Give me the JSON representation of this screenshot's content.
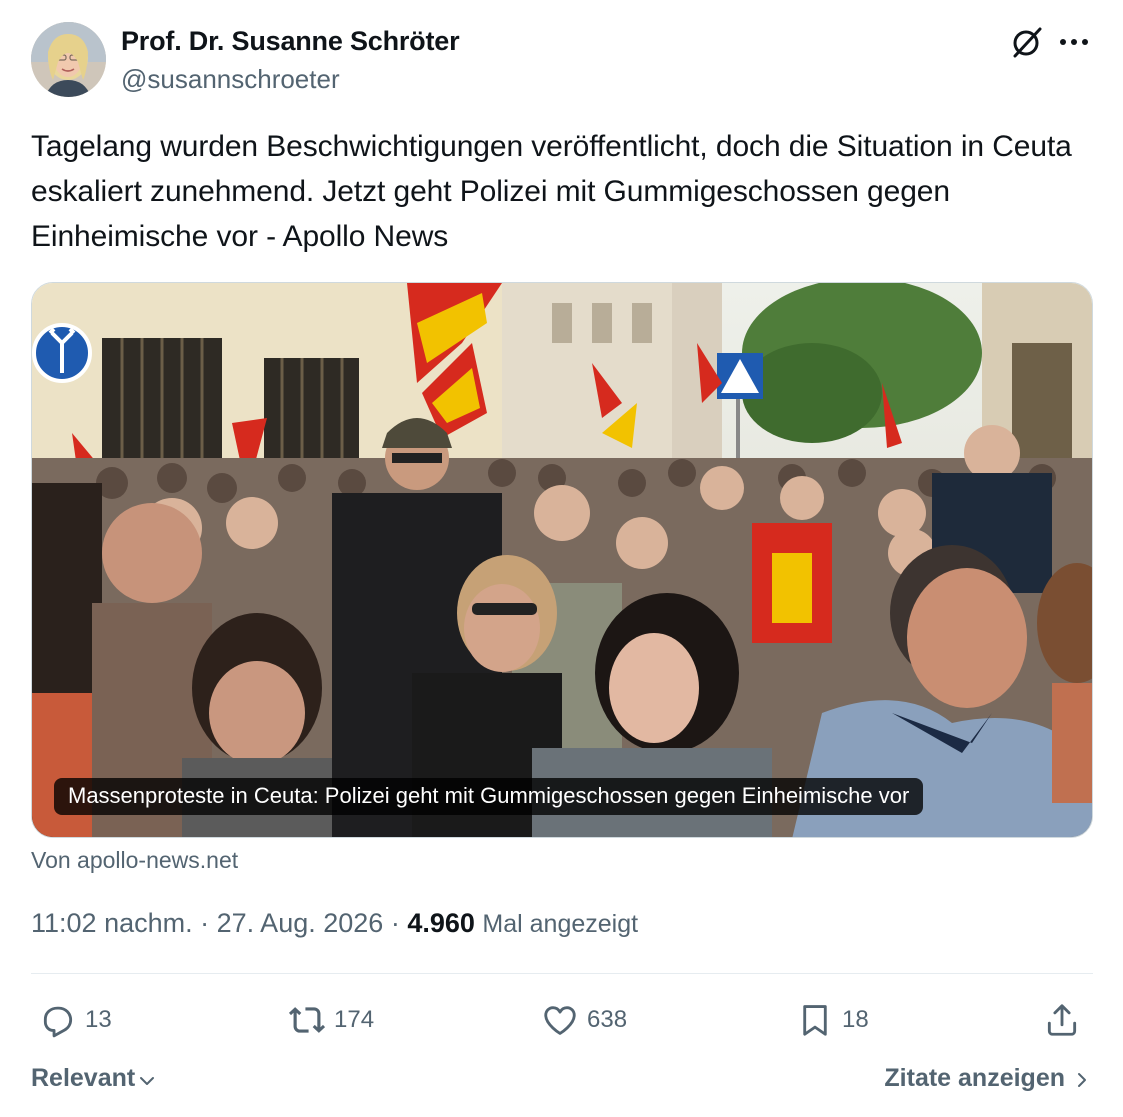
{
  "author": {
    "name": "Prof. Dr. Susanne Schröter",
    "handle": "@susannschroeter"
  },
  "post": {
    "text": "Tagelang wurden Beschwichtigungen veröffentlicht, doch die Situation in Ceuta eskaliert zunehmend. Jetzt geht Polizei mit Gummigeschossen gegen Einheimische vor - Apollo News"
  },
  "link_card": {
    "caption": "Massenproteste in Ceuta: Polizei geht mit Gummigeschossen gegen Einheimische vor",
    "source": "Von apollo-news.net"
  },
  "meta": {
    "time": "11:02 nachm.",
    "separator": "·",
    "date": "27. Aug. 2026",
    "views_count": "4.960",
    "views_label": "Mal angezeigt"
  },
  "actions": {
    "replies": "13",
    "reposts": "174",
    "likes": "638",
    "bookmarks": "18"
  },
  "footer": {
    "sort_label": "Relevant",
    "quotes_label": "Zitate anzeigen"
  },
  "icons": {
    "grok": "grok-icon",
    "more": "more-icon",
    "reply": "reply-icon",
    "repost": "repost-icon",
    "like": "like-icon",
    "bookmark": "bookmark-icon",
    "share": "share-icon"
  },
  "colors": {
    "text_primary": "#0f1419",
    "text_secondary": "#536471",
    "divider": "#e6ecf0"
  }
}
